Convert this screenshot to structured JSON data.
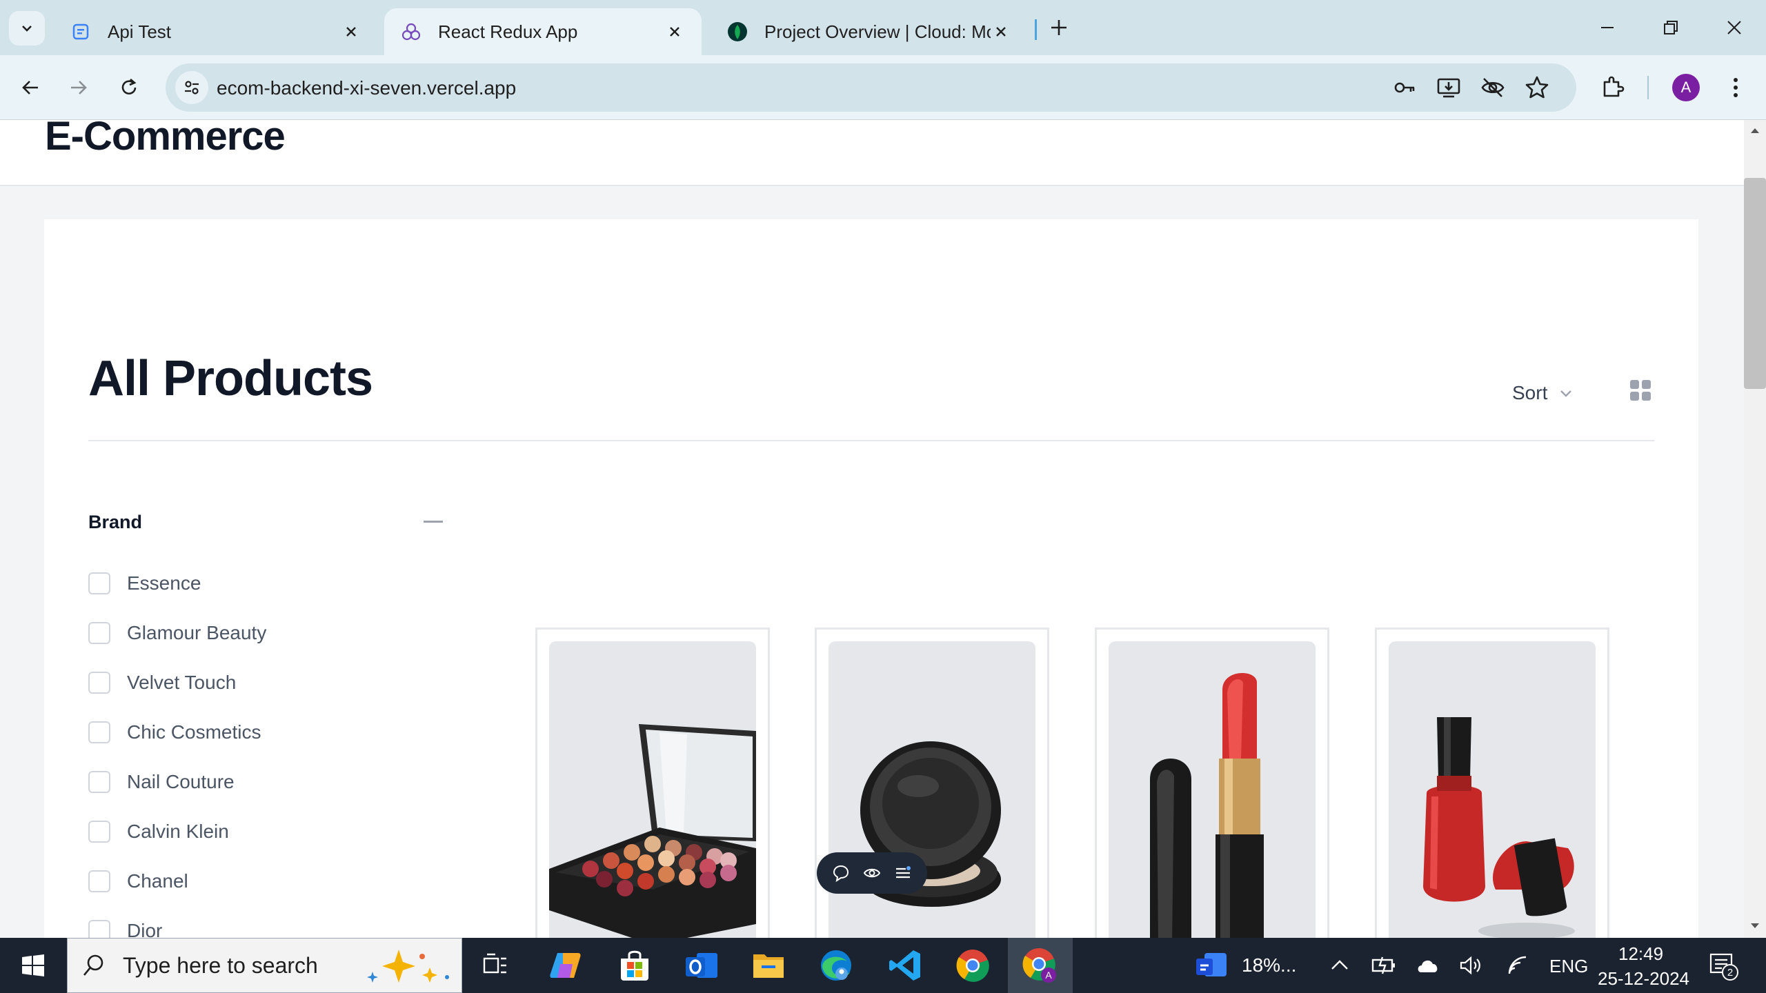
{
  "browser": {
    "tabs": [
      {
        "title": "Api Test",
        "icon": "api-test-favicon"
      },
      {
        "title": "React Redux App",
        "icon": "redux-favicon",
        "active": true
      },
      {
        "title": "Project Overview | Cloud: Mong",
        "icon": "mongodb-leaf-favicon"
      }
    ],
    "url": "ecom-backend-xi-seven.vercel.app",
    "profile_initial": "A",
    "accent": "#7b1fa2"
  },
  "site": {
    "brand": "E-Commerce"
  },
  "page": {
    "title": "All Products",
    "sort_label": "Sort",
    "filter": {
      "title": "Brand",
      "options": [
        "Essence",
        "Glamour Beauty",
        "Velvet Touch",
        "Chic Cosmetics",
        "Nail Couture",
        "Calvin Klein",
        "Chanel",
        "Dior"
      ]
    },
    "products": [
      {
        "image": "eyeshadow-palette-image"
      },
      {
        "image": "powder-compact-image"
      },
      {
        "image": "red-lipstick-image"
      },
      {
        "image": "red-nail-polish-image"
      }
    ]
  },
  "taskbar": {
    "search_placeholder": "Type here to search",
    "weather": "18%...",
    "language": "ENG",
    "time": "12:49",
    "date": "25-12-2024",
    "notifications": "2"
  }
}
